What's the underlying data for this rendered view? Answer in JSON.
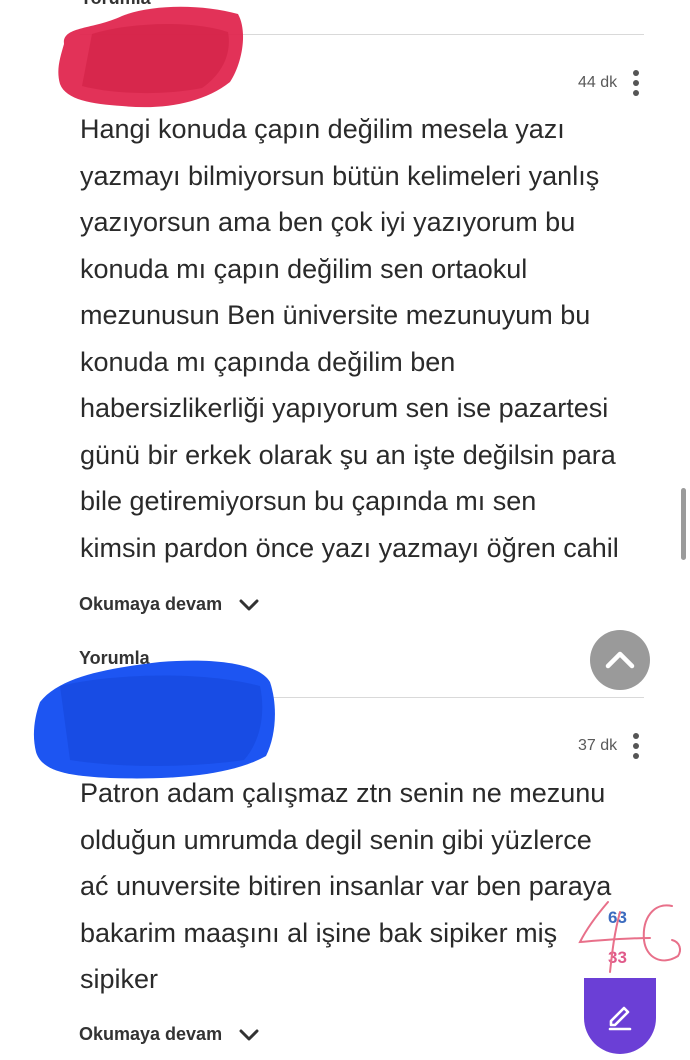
{
  "previous_comment_label": "Yorumla",
  "comments": [
    {
      "time": "44 dk",
      "lines": [
        "Hangi konuda çapın değilim mesela yazı",
        "yazmayı bilmiyorsun bütün kelimeleri yanlış",
        "yazıyorsun ama ben çok iyi yazıyorum bu",
        "konuda mı çapın değilim sen ortaokul",
        "mezunusun Ben üniversite mezunuyum bu",
        "konuda mı çapında değilim ben",
        "habersizlikerliği yapıyorum sen ise pazartesi",
        "günü bir erkek olarak şu an işte değilsin para",
        "bile getiremiyorsun bu çapında mı sen",
        "kimsin pardon önce yazı yazmayı öğren cahil"
      ],
      "read_more": "Okumaya devam",
      "comment_label": "Yorumla"
    },
    {
      "time": "37 dk",
      "lines": [
        "Patron adam çalışmaz ztn senin ne mezunu",
        "olduğun umrumda degil senin gibi yüzlerce",
        "ać unuversite bitiren insanlar var ben paraya",
        "bakarim maaşını al işine bak sipiker miş",
        "sipiker"
      ],
      "read_more": "Okumaya devam"
    }
  ],
  "vote_counter": {
    "top": "63",
    "bottom": "33"
  },
  "colors": {
    "accent_purple": "#6b3fd6",
    "redact_red": "#e0274f",
    "redact_blue": "#1d55f2",
    "count_blue": "#3b6bbf",
    "count_pink": "#e05a8a"
  },
  "icons": {
    "more_options": "kebab-vertical-icon",
    "expand": "chevron-down-icon",
    "scroll_top": "chevron-up-icon",
    "write": "pencil-icon"
  }
}
